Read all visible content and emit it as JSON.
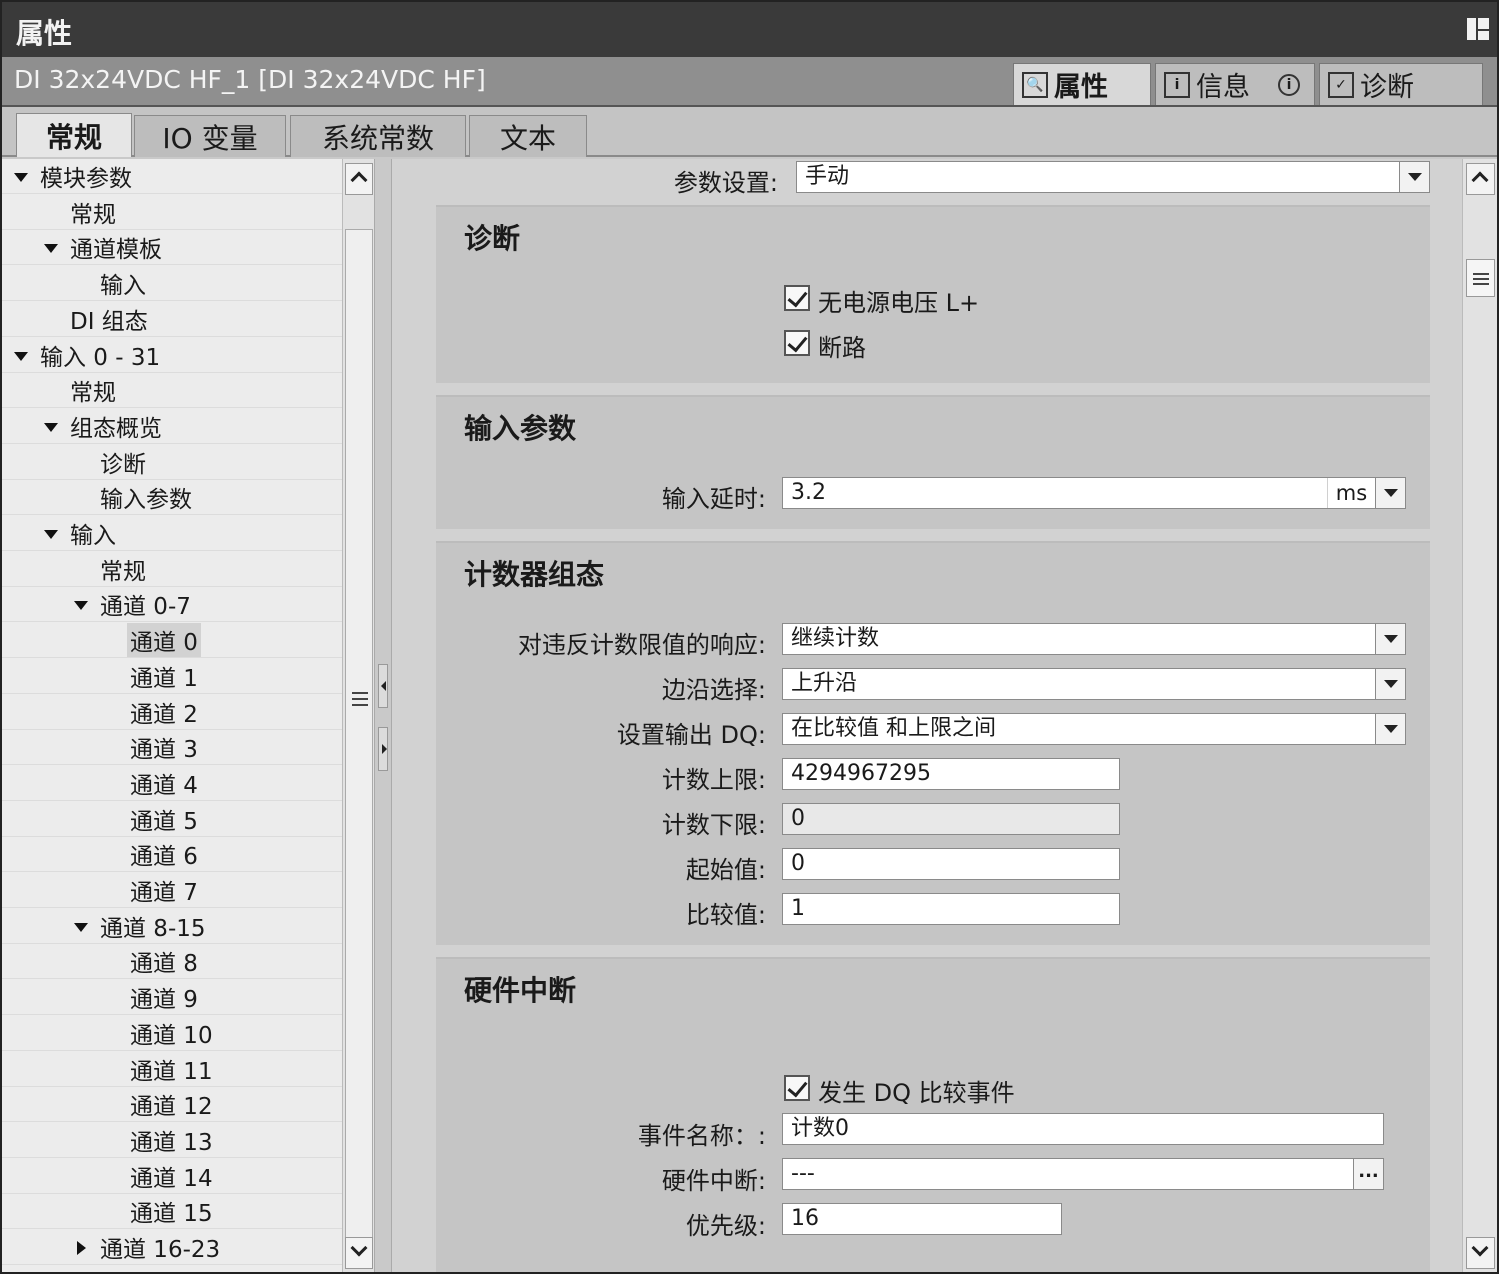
{
  "window": {
    "title": "属性",
    "object_name": "DI 32x24VDC HF_1 [DI 32x24VDC HF]"
  },
  "right_tabs": [
    {
      "label": "属性",
      "icon": "properties-icon",
      "active": true
    },
    {
      "label": "信息",
      "icon": "info-list-icon",
      "badge": "i",
      "active": false
    },
    {
      "label": "诊断",
      "icon": "diagnostics-icon",
      "active": false
    }
  ],
  "sub_tabs": [
    {
      "label": "常规",
      "active": true
    },
    {
      "label": "IO 变量",
      "active": false
    },
    {
      "label": "系统常数",
      "active": false
    },
    {
      "label": "文本",
      "active": false
    }
  ],
  "tree": [
    {
      "label": "模块参数",
      "level": 0,
      "expander": "expanded"
    },
    {
      "label": "常规",
      "level": 1,
      "expander": "none"
    },
    {
      "label": "通道模板",
      "level": 1,
      "expander": "expanded"
    },
    {
      "label": "输入",
      "level": 2,
      "expander": "none"
    },
    {
      "label": "DI 组态",
      "level": 1,
      "expander": "none"
    },
    {
      "label": "输入 0 - 31",
      "level": 0,
      "expander": "expanded"
    },
    {
      "label": "常规",
      "level": 1,
      "expander": "none"
    },
    {
      "label": "组态概览",
      "level": 1,
      "expander": "expanded"
    },
    {
      "label": "诊断",
      "level": 2,
      "expander": "none"
    },
    {
      "label": "输入参数",
      "level": 2,
      "expander": "none"
    },
    {
      "label": "输入",
      "level": 1,
      "expander": "expanded"
    },
    {
      "label": "常规",
      "level": 2,
      "expander": "none"
    },
    {
      "label": "通道 0-7",
      "level": 2,
      "expander": "expanded"
    },
    {
      "label": "通道 0",
      "level": 3,
      "expander": "none",
      "selected": true
    },
    {
      "label": "通道 1",
      "level": 3,
      "expander": "none"
    },
    {
      "label": "通道 2",
      "level": 3,
      "expander": "none"
    },
    {
      "label": "通道 3",
      "level": 3,
      "expander": "none"
    },
    {
      "label": "通道 4",
      "level": 3,
      "expander": "none"
    },
    {
      "label": "通道 5",
      "level": 3,
      "expander": "none"
    },
    {
      "label": "通道 6",
      "level": 3,
      "expander": "none"
    },
    {
      "label": "通道 7",
      "level": 3,
      "expander": "none"
    },
    {
      "label": "通道 8-15",
      "level": 2,
      "expander": "expanded"
    },
    {
      "label": "通道 8",
      "level": 3,
      "expander": "none"
    },
    {
      "label": "通道 9",
      "level": 3,
      "expander": "none"
    },
    {
      "label": "通道 10",
      "level": 3,
      "expander": "none"
    },
    {
      "label": "通道 11",
      "level": 3,
      "expander": "none"
    },
    {
      "label": "通道 12",
      "level": 3,
      "expander": "none"
    },
    {
      "label": "通道 13",
      "level": 3,
      "expander": "none"
    },
    {
      "label": "通道 14",
      "level": 3,
      "expander": "none"
    },
    {
      "label": "通道 15",
      "level": 3,
      "expander": "none"
    },
    {
      "label": "通道 16-23",
      "level": 2,
      "expander": "collapsed"
    }
  ],
  "param_setting": {
    "label": "参数设置:",
    "value": "手动"
  },
  "diagnostics": {
    "title": "诊断",
    "no_supply_voltage": {
      "label": "无电源电压 L+",
      "checked": true
    },
    "wire_break": {
      "label": "断路",
      "checked": true
    }
  },
  "input_params": {
    "title": "输入参数",
    "input_delay_label": "输入延时:",
    "input_delay_value": "3.2",
    "input_delay_unit": "ms"
  },
  "counter_config": {
    "title": "计数器组态",
    "reaction_label": "对违反计数限值的响应:",
    "reaction_value": "继续计数",
    "edge_label": "边沿选择:",
    "edge_value": "上升沿",
    "output_dq_label": "设置输出 DQ:",
    "output_dq_value": "在比较值 和上限之间",
    "upper_limit_label": "计数上限:",
    "upper_limit_value": "4294967295",
    "lower_limit_label": "计数下限:",
    "lower_limit_value": "0",
    "start_label": "起始值:",
    "start_value": "0",
    "compare_label": "比较值:",
    "compare_value": "1"
  },
  "hw_interrupt": {
    "title": "硬件中断",
    "dq_compare_event": {
      "label": "发生 DQ 比较事件",
      "checked": true
    },
    "event_name_label": "事件名称：:",
    "event_name_value": "计数0",
    "hw_interrupt_label": "硬件中断:",
    "hw_interrupt_value": "---",
    "priority_label": "优先级:",
    "priority_value": "16"
  }
}
